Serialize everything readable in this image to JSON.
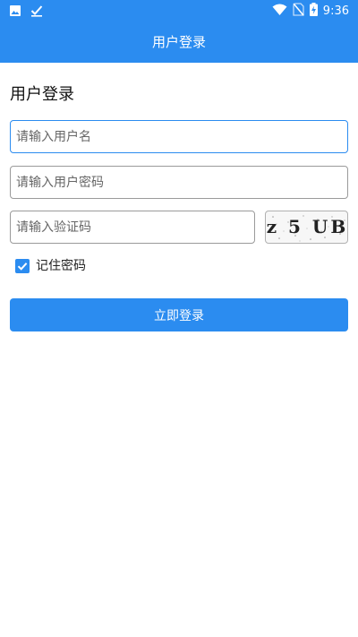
{
  "status_bar": {
    "time": "9:36",
    "icons": [
      "image-icon",
      "check-icon",
      "wifi-icon",
      "no-sim-icon",
      "battery-charging-icon"
    ]
  },
  "app_bar": {
    "title": "用户登录"
  },
  "form": {
    "heading": "用户登录",
    "username": {
      "value": "",
      "placeholder": "请输入用户名"
    },
    "password": {
      "value": "",
      "placeholder": "请输入用户密码"
    },
    "captcha": {
      "value": "",
      "placeholder": "请输入验证码",
      "image_text": "z 5 UB"
    },
    "remember": {
      "label": "记住密码",
      "checked": true
    },
    "submit_label": "立即登录"
  },
  "colors": {
    "primary": "#2b8cf0",
    "background": "#ffffff",
    "text": "#111111"
  }
}
